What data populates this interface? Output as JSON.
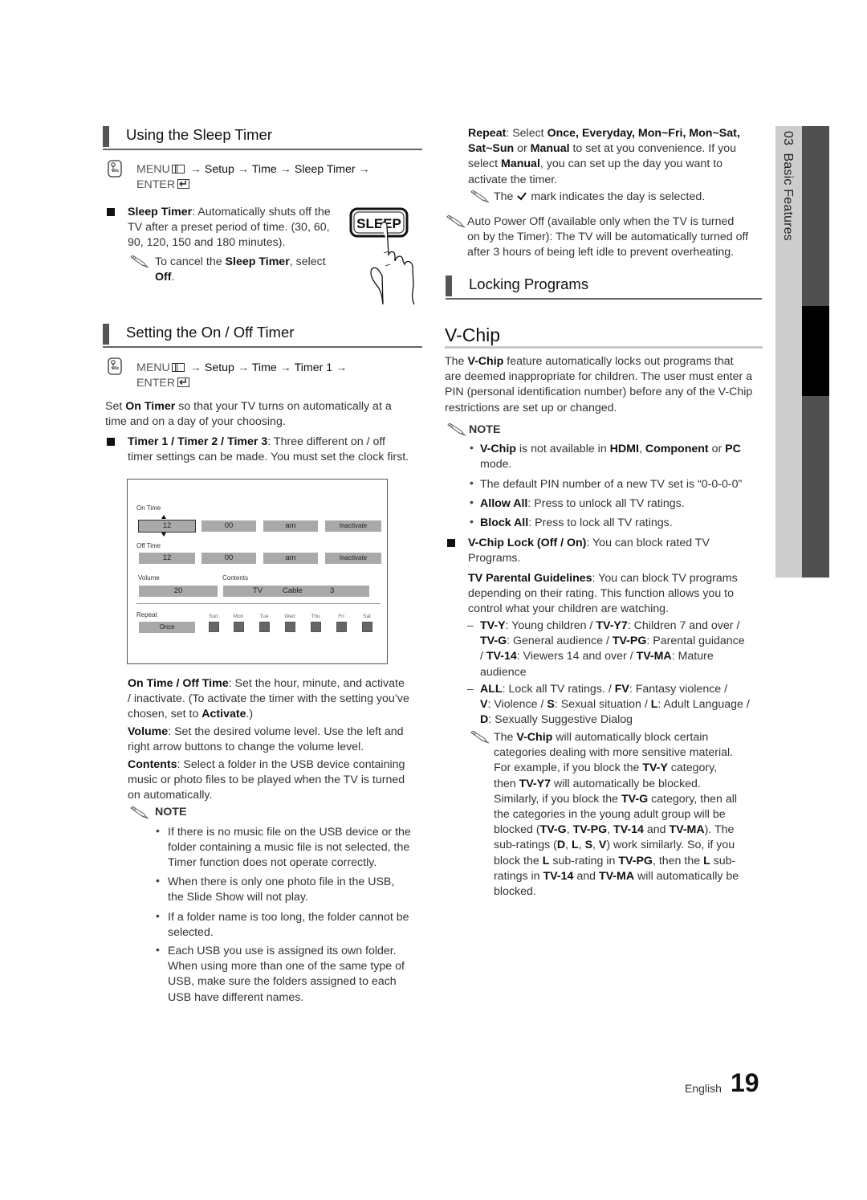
{
  "left": {
    "sleep": {
      "heading": "Using the Sleep Timer",
      "menu": {
        "menu": "MENU",
        "arrow": "→",
        "steps": [
          "Setup",
          "Time",
          "Sleep Timer"
        ],
        "enter": "ENTER"
      },
      "bullet_term": "Sleep Timer",
      "bullet_text_1": ": Automatically shuts off the",
      "bullet_text_2": "TV after a preset period of time. (30, 60,",
      "bullet_text_3": "90, 120, 150 and 180 minutes).",
      "note_1": "To cancel the ",
      "note_term": "Sleep Timer",
      "note_2": ", select",
      "note_3": "Off",
      "note_4": ".",
      "button_label": "SLEEP"
    },
    "onoff": {
      "heading": "Setting the On / Off Timer",
      "menu": {
        "menu": "MENU",
        "arrow": "→",
        "steps": [
          "Setup",
          "Time",
          "Timer 1"
        ],
        "enter": "ENTER"
      },
      "intro_1": "Set ",
      "intro_term": "On Timer",
      "intro_2": " so that your TV turns on automatically at a",
      "intro_3": "time and on a day of your choosing.",
      "bullet_term": "Timer 1 / Timer 2 / Timer 3",
      "bullet_text_1": ": Three different on / off",
      "bullet_text_2": "timer settings can be made. You must set the clock first."
    },
    "figure": {
      "on_time_label": "On Time",
      "on_time": [
        "12",
        "00",
        "am",
        "Inactivate"
      ],
      "off_time_label": "Off Time",
      "off_time": [
        "12",
        "00",
        "am",
        "Inactivate"
      ],
      "volume_label": "Volume",
      "volume": "20",
      "contents_label": "Contents",
      "contents": [
        "TV",
        "Cable",
        "3"
      ],
      "repeat_label": "Repeat",
      "repeat": "Once",
      "days": [
        "Sun",
        "Mon",
        "Tue",
        "Wed",
        "Thu",
        "Fri",
        "Sat"
      ]
    },
    "desc": {
      "ontime_term": "On Time / Off Time",
      "ontime_1": ": Set the hour, minute, and activate",
      "ontime_2": "/ inactivate. (To activate the timer with the setting you’ve",
      "ontime_3": "chosen, set to ",
      "ontime_term2": "Activate",
      "ontime_4": ".)",
      "volume_term": "Volume",
      "volume_1": ": Set the desired volume level. Use the left and",
      "volume_2": "right arrow buttons to change the volume level.",
      "contents_term": "Contents",
      "contents_1": ": Select a folder in the USB device containing",
      "contents_2": "music or photo files to be played when the TV is turned",
      "contents_3": "on automatically."
    },
    "note_label": "NOTE",
    "notes": [
      [
        "If there is no music file on the USB device or the",
        "folder containing a music file is not selected, the",
        "Timer function does not operate correctly."
      ],
      [
        "When there is only one photo file in the USB,",
        "the Slide Show will not play."
      ],
      [
        "If a folder name is too long, the folder cannot be",
        "selected."
      ],
      [
        "Each USB you use is assigned its own folder.",
        "When using more than one of the same type of",
        "USB, make sure the folders assigned to each",
        "USB have different names."
      ]
    ]
  },
  "right": {
    "repeat": {
      "term": "Repeat",
      "t1": ": Select ",
      "opts1": "Once, Everyday, Mon~Fri, Mon~Sat,",
      "opts2": "Sat~Sun",
      "t2": " or ",
      "manual": "Manual",
      "t3": " to set at you convenience. If you",
      "t4": "select ",
      "manual2": "Manual",
      "t5": ", you can set up the day you want to",
      "t6": "activate the timer.",
      "note_1": "The ",
      "note_2": " mark indicates the day is selected."
    },
    "auto_power": [
      "Auto Power Off (available only when the TV is turned",
      "on by the Timer): The TV will be automatically turned off",
      "after 3 hours of being left idle to prevent overheating."
    ],
    "locking_heading": "Locking Programs",
    "vchip_heading": "V-Chip",
    "vchip_intro": {
      "a": "The ",
      "term": "V-Chip",
      "b": " feature automatically locks out programs that",
      "l2": "are deemed inappropriate for children. The user must enter a",
      "l3": "PIN (personal identification number) before any of the V-Chip",
      "l4": "restrictions are set up or changed."
    },
    "note_label": "NOTE",
    "vchip_notes": {
      "n1_term": "V-Chip",
      "n1_a": " is not available in ",
      "n1_hdmi": "HDMI",
      "n1_b": ", ",
      "n1_comp": "Component",
      "n1_c": " or ",
      "n1_pc": "PC",
      "n1_d": "mode.",
      "n2": "The default PIN number of a new TV set is “0-0-0-0”",
      "n3_term": "Allow All",
      "n3": ": Press to unlock all TV ratings.",
      "n4_term": "Block All",
      "n4": ": Press to lock all TV ratings."
    },
    "lock": {
      "term": "V-Chip Lock (Off / On)",
      "a": ": You can block rated TV",
      "b": "Programs."
    },
    "tvpg": {
      "term": "TV Parental Guidelines",
      "a": ": You can block TV programs",
      "b": "depending on their rating. This function allows you to",
      "c": "control what your children are watching."
    },
    "ratings": [
      {
        "code": "TV-Y",
        "desc": "Young children"
      },
      {
        "code": "TV-Y7",
        "desc": "Children 7 and over"
      },
      {
        "code": "TV-G",
        "desc": "General audience"
      },
      {
        "code": "TV-PG",
        "desc": "Parental guidance"
      },
      {
        "code": "TV-14",
        "desc": "Viewers 14 and over"
      },
      {
        "code": "TV-MA",
        "desc": "Mature audience"
      }
    ],
    "subratings": [
      {
        "code": "ALL",
        "desc": "Lock all TV ratings."
      },
      {
        "code": "FV",
        "desc": "Fantasy violence"
      },
      {
        "code": "V",
        "desc": "Violence"
      },
      {
        "code": "S",
        "desc": "Sexual situation"
      },
      {
        "code": "L",
        "desc": "Adult Language"
      },
      {
        "code": "D",
        "desc": "Sexually Suggestive Dialog"
      }
    ],
    "final_note": [
      "The <b>V-Chip</b> will automatically block certain",
      "categories dealing with more sensitive material.",
      "For example, if you block the <b>TV-Y</b> category,",
      "then <b>TV-Y7</b> will automatically be blocked.",
      "Similarly, if you block the <b>TV-G</b> category, then all",
      "the categories in the young adult group will be",
      "blocked (<b>TV-G</b>, <b>TV-PG</b>, <b>TV-14</b> and <b>TV-MA</b>). The",
      "sub-ratings (<b>D</b>, <b>L</b>, <b>S</b>, <b>V</b>) work similarly. So, if you",
      "block the <b>L</b> sub-rating in <b>TV-PG</b>, then the <b>L</b> sub-",
      "ratings in <b>TV-14</b> and <b>TV-MA</b> will automatically be",
      "blocked."
    ]
  },
  "side_tab": {
    "chapter": "03",
    "title": "Basic Features"
  },
  "footer": {
    "language": "English",
    "page": "19"
  },
  "colors": {
    "heading_bar": "#555555",
    "rule": "#666666",
    "tab_light": "#cdcdcd",
    "tab_dark": "#505050",
    "tab_active": "#000000",
    "field": "#a9a9a9"
  }
}
